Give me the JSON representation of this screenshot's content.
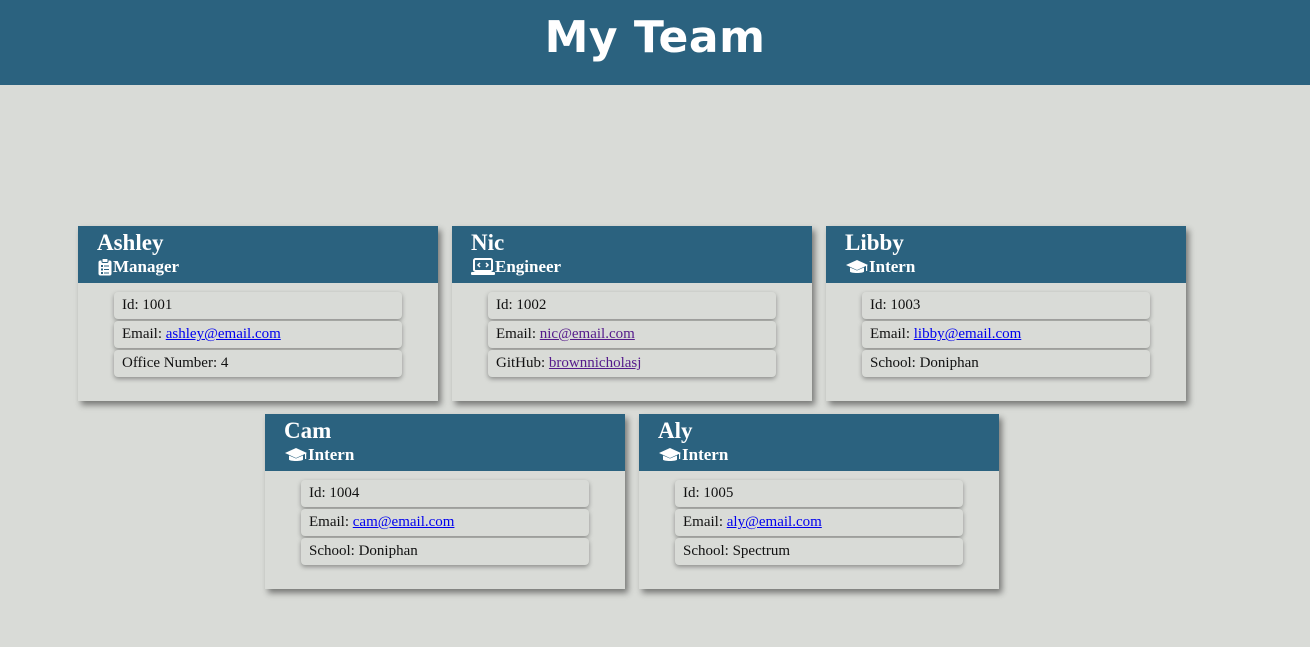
{
  "header": {
    "title": "My Team"
  },
  "cards": [
    {
      "name": "Ashley",
      "role": "Manager",
      "role_icon": "clipboard-icon",
      "id_label": "Id: 1001",
      "email_label": "Email: ",
      "email": "ashley@email.com",
      "extra_label": "Office Number: 4"
    },
    {
      "name": "Nic",
      "role": "Engineer",
      "role_icon": "laptop-code-icon",
      "id_label": "Id: 1002",
      "email_label": "Email: ",
      "email": "nic@email.com",
      "extra_label": "GitHub: ",
      "extra_link": "brownnicholasj"
    },
    {
      "name": "Libby",
      "role": "Intern",
      "role_icon": "graduation-cap-icon",
      "id_label": "Id: 1003",
      "email_label": "Email: ",
      "email": "libby@email.com",
      "extra_label": "School: Doniphan"
    },
    {
      "name": "Cam",
      "role": "Intern",
      "role_icon": "graduation-cap-icon",
      "id_label": "Id: 1004",
      "email_label": "Email: ",
      "email": "cam@email.com",
      "extra_label": "School: Doniphan"
    },
    {
      "name": "Aly",
      "role": "Intern",
      "role_icon": "graduation-cap-icon",
      "id_label": "Id: 1005",
      "email_label": "Email: ",
      "email": "aly@email.com",
      "extra_label": "School: Spectrum"
    }
  ],
  "colors": {
    "header_bg": "#2b627f",
    "page_bg": "#d9dbd7",
    "link": "#0000ee",
    "link_visited": "#551a8b"
  }
}
